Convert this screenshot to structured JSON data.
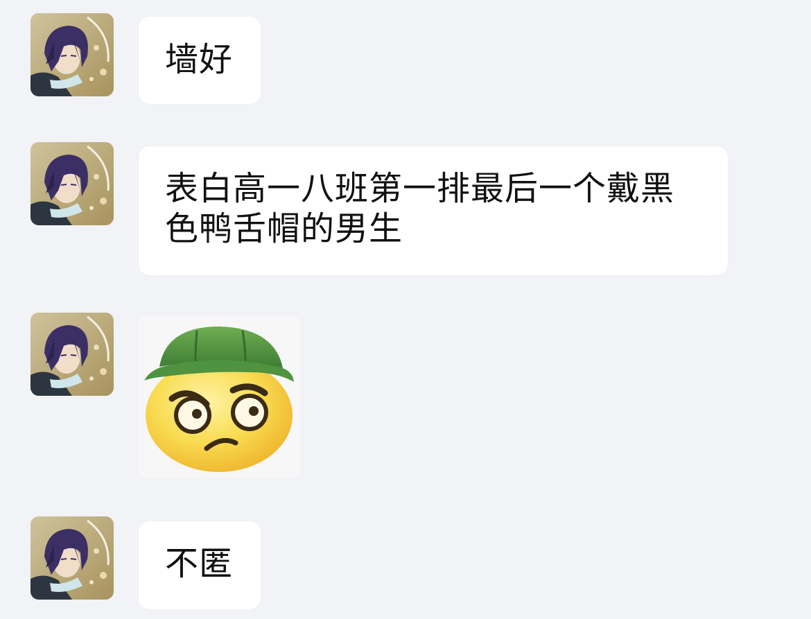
{
  "chat": {
    "messages": [
      {
        "type": "text",
        "text": "墙好",
        "avatar": "anime-boy-avatar"
      },
      {
        "type": "text",
        "text": "表白高一八班第一排最后一个戴黑色鸭舌帽的男生",
        "avatar": "anime-boy-avatar"
      },
      {
        "type": "sticker",
        "sticker": "angry-emoji-green-hat",
        "avatar": "anime-boy-avatar"
      },
      {
        "type": "text",
        "text": "不匿",
        "avatar": "anime-boy-avatar"
      }
    ]
  },
  "colors": {
    "background": "#f2f3f7",
    "bubble": "#ffffff",
    "text": "#111111",
    "hat_green": "#4f9340",
    "emoji_yellow": "#f7d64a"
  }
}
